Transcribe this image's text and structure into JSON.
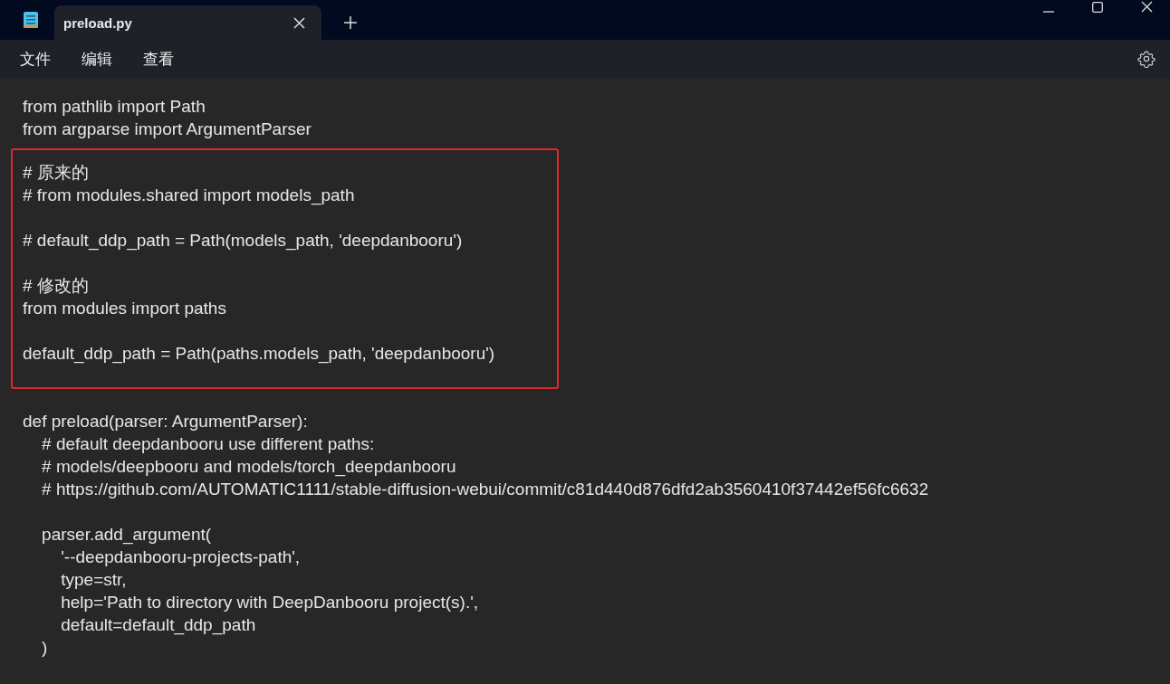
{
  "tab": {
    "title": "preload.py",
    "selected": true
  },
  "menu": [
    {
      "label": "文件"
    },
    {
      "label": "编辑"
    },
    {
      "label": "查看"
    }
  ],
  "segments": [
    {
      "highlighted": false,
      "paragraphs": [
        [
          "from pathlib import Path",
          "from argparse import ArgumentParser"
        ]
      ]
    },
    {
      "highlighted": true,
      "paragraphs": [
        [
          "# 原来的",
          "# from modules.shared import models_path"
        ],
        [
          "# default_ddp_path = Path(models_path, 'deepdanbooru')"
        ],
        [
          "# 修改的",
          "from modules import paths"
        ],
        [
          "default_ddp_path = Path(paths.models_path, 'deepdanbooru')"
        ]
      ]
    },
    {
      "highlighted": false,
      "paragraphs": [
        [
          "def preload(parser: ArgumentParser):",
          "    # default deepdanbooru use different paths:",
          "    # models/deepbooru and models/torch_deepdanbooru",
          "    # https://github.com/AUTOMATIC1111/stable-diffusion-webui/commit/c81d440d876dfd2ab3560410f37442ef56fc6632"
        ],
        [
          "    parser.add_argument(",
          "        '--deepdanbooru-projects-path',",
          "        type=str,",
          "        help='Path to directory with DeepDanbooru project(s).',",
          "        default=default_ddp_path",
          "    )"
        ]
      ]
    }
  ]
}
